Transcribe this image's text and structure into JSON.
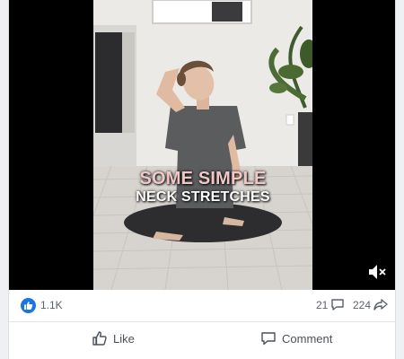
{
  "video": {
    "caption_line1": "SOME SIMPLE",
    "caption_line2": "NECK STRETCHES"
  },
  "stats": {
    "reactions": "1.1K",
    "comments": "21",
    "shares": "224"
  },
  "actions": {
    "like_label": "Like",
    "comment_label": "Comment"
  },
  "icons": {
    "reaction": "like-thumb-icon",
    "comments": "comment-bubble-icon",
    "shares": "share-arrow-icon",
    "mute": "speaker-muted-icon"
  },
  "colors": {
    "accent": "#1b74e4",
    "caption_highlight": "#f1c6c6"
  }
}
